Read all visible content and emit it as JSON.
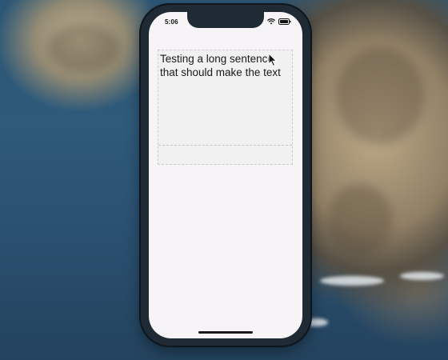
{
  "wallpaper": {
    "description_icon": "coastal-rocks-wallpaper"
  },
  "status_bar": {
    "time": "5:06",
    "icons": [
      "wifi-icon",
      "battery-icon"
    ]
  },
  "text_editor": {
    "lines": [
      "Testing a long sentence",
      "that should make the text"
    ],
    "value": "Testing a long sentence that should make the text"
  },
  "pointer": {
    "icon": "mouse-pointer-icon"
  },
  "colors": {
    "screen_background": "#f6f4f6",
    "phone_frame": "#1f2a35",
    "text": "#1a1a1a"
  }
}
